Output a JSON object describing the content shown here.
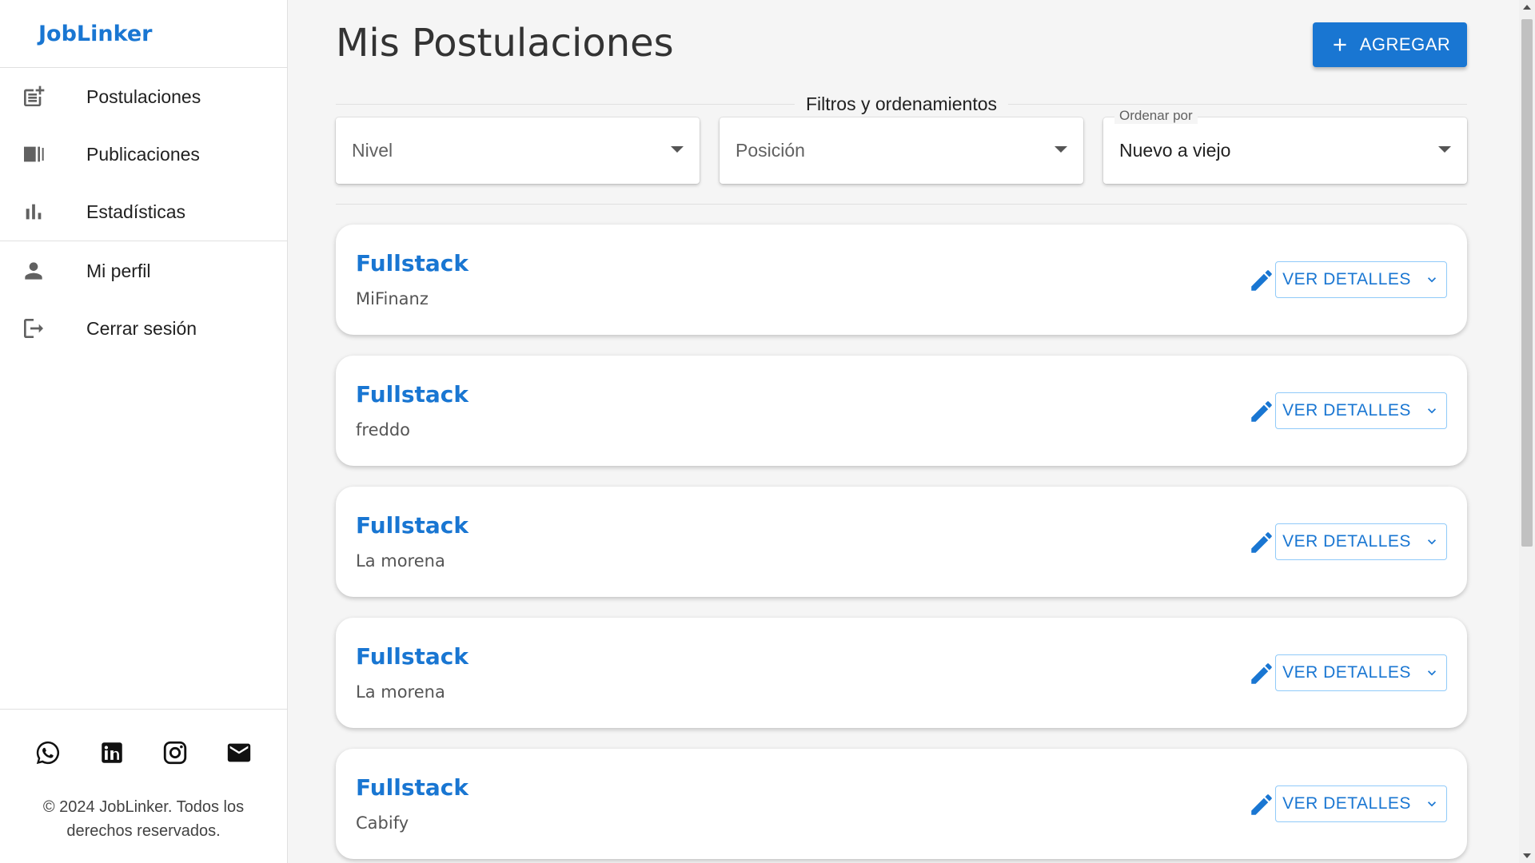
{
  "brand": "JobLinker",
  "nav": {
    "items": [
      {
        "label": "Postulaciones",
        "icon": "post-add-icon"
      },
      {
        "label": "Publicaciones",
        "icon": "library-books-icon"
      },
      {
        "label": "Estadísticas",
        "icon": "bar-chart-icon"
      }
    ],
    "account": [
      {
        "label": "Mi perfil",
        "icon": "person-icon"
      },
      {
        "label": "Cerrar sesión",
        "icon": "logout-icon"
      }
    ]
  },
  "footer": {
    "social": [
      "whatsapp-icon",
      "linkedin-icon",
      "instagram-icon",
      "mail-icon"
    ],
    "copyright": "© 2024 JobLinker. Todos los derechos reservados."
  },
  "header": {
    "title": "Mis Postulaciones",
    "add_label": "AGREGAR"
  },
  "filters": {
    "title": "Filtros y ordenamientos",
    "nivel_placeholder": "Nivel",
    "posicion_placeholder": "Posición",
    "sort_label": "Ordenar por",
    "sort_value": "Nuevo a viejo"
  },
  "cards": [
    {
      "title": "Fullstack",
      "company": "MiFinanz",
      "details_label": "VER DETALLES"
    },
    {
      "title": "Fullstack",
      "company": "freddo",
      "details_label": "VER DETALLES"
    },
    {
      "title": "Fullstack",
      "company": "La morena",
      "details_label": "VER DETALLES"
    },
    {
      "title": "Fullstack",
      "company": "La morena",
      "details_label": "VER DETALLES"
    },
    {
      "title": "Fullstack",
      "company": "Cabify",
      "details_label": "VER DETALLES"
    }
  ],
  "colors": {
    "primary": "#1976d2",
    "background": "#f5f5f5"
  }
}
